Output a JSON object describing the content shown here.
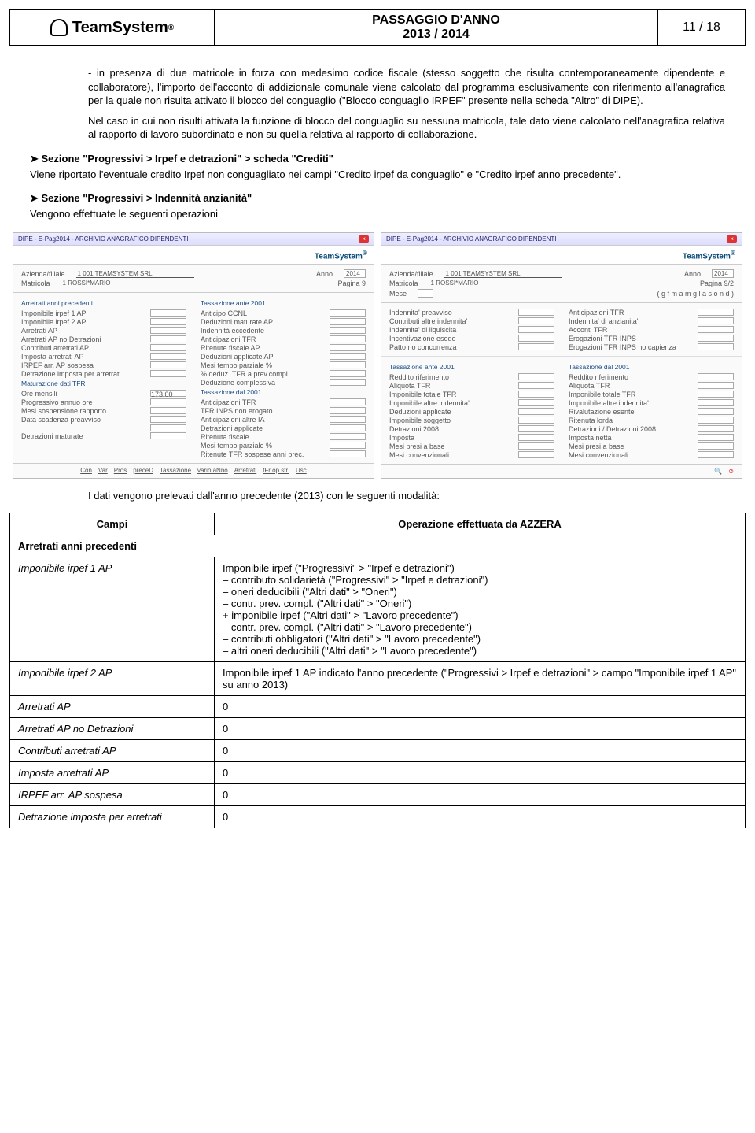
{
  "header": {
    "brand": "TeamSystem",
    "title_line1": "PASSAGGIO D'ANNO",
    "title_line2": "2013 / 2014",
    "page_num": "11 / 18"
  },
  "para1": "in presenza di due matricole in forza con medesimo codice fiscale (stesso soggetto che risulta contemporaneamente dipendente e collaboratore), l'importo dell'acconto di addizionale comunale viene calcolato dal programma esclusivamente con riferimento all'anagrafica per la quale non risulta attivato il blocco del conguaglio (\"Blocco conguaglio IRPEF\" presente nella scheda \"Altro\" di DIPE).",
  "para2": "Nel caso in cui non risulti attivata la funzione di blocco del conguaglio su nessuna matricola, tale dato viene calcolato nell'anagrafica relativa al rapporto di lavoro subordinato e non su quella relativa al rapporto di collaborazione.",
  "section1": {
    "title": "Sezione \"Progressivi > Irpef e detrazioni\" > scheda \"Crediti\"",
    "desc": "Viene riportato l'eventuale credito Irpef non conguagliato nei campi \"Credito irpef da conguaglio\" e \"Credito irpef anno precedente\"."
  },
  "section2": {
    "title": "Sezione \"Progressivi > Indennità anzianità\"",
    "desc": "Vengono effettuate le seguenti operazioni"
  },
  "screenshots": {
    "left": {
      "window_title": "DIPE - E-Pag2014 - ARCHIVIO ANAGRAFICO DIPENDENTI",
      "brand": "TeamSystem",
      "azienda_label": "Azienda/filiale",
      "azienda_val": "1   001 TEAMSYSTEM SRL",
      "matricola_label": "Matricola",
      "matricola_val": "1 ROSSI*MARIO",
      "anno_label": "Anno",
      "anno_val": "2014",
      "pagina_label": "Pagina 9",
      "group1_title": "Arretrati anni precedenti",
      "group1_fields": [
        "Imponibile irpef 1 AP",
        "Imponibile irpef 2 AP",
        "Arretrati AP",
        "Arretrati AP no Detrazioni",
        "Contributi arretrati AP",
        "Imposta arretrati AP",
        "IRPEF arr. AP sospesa",
        "Detrazione imposta per arretrati"
      ],
      "group2_title": "Maturazione dati TFR",
      "group2_fields": [
        "Ore mensili",
        "Progressivo annuo ore",
        "Mesi sospensione rapporto",
        "Data scadenza preavviso",
        "",
        "Detrazioni maturate"
      ],
      "group2_ore": "173.00",
      "group3_title": "Tassazione ante 2001",
      "group3_fields": [
        "Anticipo CCNL",
        "Deduzioni maturate AP",
        "Indennità eccedente",
        "Anticipazioni TFR",
        "Ritenute fiscale AP",
        "Deduzioni applicate AP",
        "Mesi tempo parziale %",
        "% deduz. TFR a prev.compl.",
        "Deduzione complessiva"
      ],
      "group4_title": "Tassazione dal 2001",
      "group4_fields": [
        "Anticipazioni TFR",
        "TFR INPS non erogato",
        "Anticipazioni altre IA",
        "Detrazioni applicate",
        "Ritenuta fiscale",
        "Mesi tempo parziale %",
        "Ritenute TFR sospese anni prec."
      ],
      "footer_buttons": [
        "Con",
        "Var",
        "Pros",
        "preceD",
        "Tassazione",
        "vario aNno",
        "Arretrati",
        "tFr op.str.",
        "Usc"
      ]
    },
    "right": {
      "window_title": "DIPE - E-Pag2014 - ARCHIVIO ANAGRAFICO DIPENDENTI",
      "brand": "TeamSystem",
      "azienda_label": "Azienda/filiale",
      "azienda_val": "1   001 TEAMSYSTEM SRL",
      "matricola_label": "Matricola",
      "matricola_val": "1 ROSSI*MARIO",
      "mese_label": "Mese",
      "anno_label": "Anno",
      "anno_val": "2014",
      "pagina_label": "Pagina 9/2",
      "months": "( g f m a m g l a s o n d )",
      "group1_fields_left": [
        "Indennita' preavviso",
        "Contributi altre indennita'",
        "Indennita' di liquiscita",
        "Incentivazione esodo",
        "Patto no concorrenza"
      ],
      "group1_fields_right": [
        "Anticipazioni TFR",
        "Indennita' di anzianita'",
        "Acconti TFR",
        "Erogazioni TFR INPS",
        "Erogazioni TFR INPS no capienza"
      ],
      "group2_title": "Tassazione ante 2001",
      "group2_fields": [
        "Reddito riferimento",
        "Aliquota TFR",
        "Imponibile totale TFR",
        "Imponibile altre indennita'",
        "Deduzioni applicate",
        "Imponibile soggetto",
        "Detrazioni 2008",
        "Imposta",
        "Mesi presi a base",
        "Mesi convenzionali"
      ],
      "group3_title": "Tassazione dal 2001",
      "group3_fields": [
        "Reddito riferimento",
        "Aliquota TFR",
        "Imponibile totale TFR",
        "Imponibile altre indennita'",
        "Rivalutazione esente",
        "Ritenuta lorda",
        "Detrazioni / Detrazioni 2008",
        "Imposta netta",
        "Mesi presi a base",
        "Mesi convenzionali"
      ]
    }
  },
  "below_shots": "I dati vengono prelevati dall'anno precedente (2013) con le seguenti modalità:",
  "table": {
    "th1": "Campi",
    "th2": "Operazione effettuata da AZZERA",
    "header_row": "Arretrati anni precedenti",
    "rows": [
      {
        "label": "Imponibile irpef 1 AP",
        "lines": [
          "Imponibile irpef (\"Progressivi\" > \"Irpef e detrazioni\")",
          "– contributo solidarietà (\"Progressivi\" > \"Irpef e detrazioni\")",
          "– oneri deducibili (\"Altri dati\" > \"Oneri\")",
          "– contr. prev. compl. (\"Altri dati\" > \"Oneri\")",
          "+ imponibile irpef (\"Altri dati\" > \"Lavoro precedente\")",
          "– contr. prev. compl. (\"Altri dati\" > \"Lavoro precedente\")",
          "– contributi obbligatori (\"Altri dati\" > \"Lavoro precedente\")",
          "– altri oneri deducibili (\"Altri dati\" > \"Lavoro precedente\")"
        ]
      },
      {
        "label": "Imponibile irpef 2 AP",
        "lines": [
          "Imponibile irpef 1 AP indicato l'anno precedente (\"Progressivi > Irpef e detrazioni\" > campo \"Imponibile irpef 1 AP\" su anno 2013)"
        ]
      },
      {
        "label": "Arretrati AP",
        "lines": [
          "0"
        ]
      },
      {
        "label": "Arretrati AP no Detrazioni",
        "lines": [
          "0"
        ]
      },
      {
        "label": "Contributi arretrati AP",
        "lines": [
          "0"
        ]
      },
      {
        "label": "Imposta arretrati AP",
        "lines": [
          "0"
        ]
      },
      {
        "label": "IRPEF arr. AP sospesa",
        "lines": [
          "0"
        ]
      },
      {
        "label": "Detrazione imposta per arretrati",
        "lines": [
          "0"
        ]
      }
    ]
  }
}
